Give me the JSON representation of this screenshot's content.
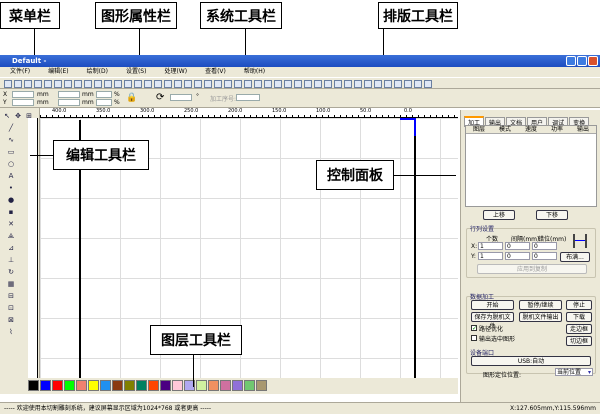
{
  "callouts": {
    "menu": "菜单栏",
    "shape_attr": "图形属性栏",
    "system": "系统工具栏",
    "layout": "排版工具栏",
    "edit": "编辑工具栏",
    "control": "控制面板",
    "layer": "图层工具栏"
  },
  "window": {
    "title": "Default -"
  },
  "menu": [
    "文件(F)",
    "编辑(E)",
    "绘制(D)",
    "设置(S)",
    "处理(W)",
    "查看(V)",
    "帮助(H)"
  ],
  "propbar": {
    "x_label": "X",
    "y_label": "Y",
    "unit_mm": "mm",
    "unit_pct": "%",
    "degree": "°",
    "process_order": "加工序号:"
  },
  "ruler_ticks": [
    "400.0",
    "350.0",
    "300.0",
    "250.0",
    "200.0",
    "150.0",
    "100.0",
    "50.0",
    "0.0"
  ],
  "panel": {
    "tabs": [
      "加工",
      "输出",
      "文档",
      "用户",
      "调试",
      "变换"
    ],
    "columns": [
      "图层",
      "模式",
      "速度",
      "功率",
      "输出"
    ],
    "move_up": "上移",
    "move_down": "下移",
    "array_title": "行列设置",
    "array_cols": [
      "个数",
      "间隔(mm)",
      "错位(mm)"
    ],
    "x_label": "X:",
    "y_label": "Y:",
    "x_values": [
      "1",
      "0",
      "0"
    ],
    "y_values": [
      "1",
      "0",
      "0"
    ],
    "layout_btn": "布满...",
    "apply_copy": "应用到复制",
    "data_title": "数据加工",
    "start": "开始",
    "pause": "暂停/继续",
    "stop": "停止",
    "save_offline": "保存为脱机文件",
    "offline_output": "脱机文件输出",
    "download": "下载",
    "path_opt": "路径优化",
    "path_opt_checked": true,
    "output_selected": "输出选中图形",
    "output_selected_checked": false,
    "walk_frame": "走边框",
    "cut_frame": "切边框",
    "port_title": "设备端口",
    "usb": "USB:自动",
    "locate_label": "图形定位位置:",
    "locate_value": "当前位置"
  },
  "palette": [
    "#000000",
    "#0000ff",
    "#ff0000",
    "#00ff00",
    "#f08070",
    "#ffff00",
    "#2090f0",
    "#8b3a10",
    "#808000",
    "#008060",
    "#ff4500",
    "#4b0082",
    "#ffc8d8",
    "#b0a8f0",
    "#d0f0a0",
    "#f09060",
    "#d070a0",
    "#9070d8",
    "#70c870",
    "#a89870"
  ],
  "status": {
    "message": "----- 欢迎使用本切割雕刻系统，建议屏幕显示区域为1024*768 或者更高 -----",
    "coords": "X:127.605mm,Y:115.596mm"
  }
}
